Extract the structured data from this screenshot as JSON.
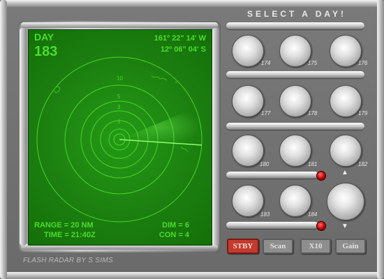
{
  "screen": {
    "day_label": "DAY",
    "day_value": "183",
    "longitude": "161º 22\" 14' W",
    "latitude": "12º 06\" 04' S",
    "range": "RANGE = 20 NM",
    "time": "TIME = 21:40Z",
    "dim": "DIM = 6",
    "con": "CON = 4",
    "ring_labels": [
      "1",
      "3",
      "5",
      "10"
    ]
  },
  "panel": {
    "title": "SELECT A DAY!",
    "days": [
      "174",
      "175",
      "176",
      "177",
      "178",
      "179",
      "180",
      "181",
      "182",
      "183",
      "184"
    ]
  },
  "controls": {
    "stby": "STBY",
    "scan": "Scan",
    "x10": "X10",
    "gain": "Gain"
  },
  "credit": "FLASH RADAR BY S SIMS",
  "colors": {
    "screen": "#1b7d0f",
    "phosphor": "#4bdc2c",
    "panel": "#6e6e6e",
    "stby": "#c13b2e",
    "led": "#c40000"
  }
}
